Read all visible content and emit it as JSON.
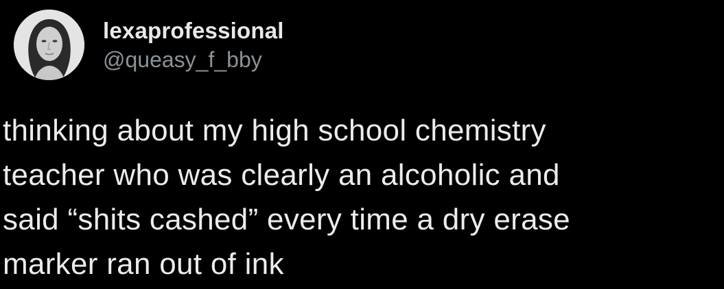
{
  "tweet": {
    "author": {
      "display_name": "lexaprofessional",
      "handle": "@queasy_f_bby",
      "avatar_icon": "profile-photo"
    },
    "text": "thinking about my high school chemistry\nteacher who was clearly an alcoholic and\nsaid “shits cashed” every time a dry erase\nmarker ran out of ink"
  },
  "colors": {
    "background": "#000000",
    "text": "#e7e9ea",
    "handle": "#8b9298"
  }
}
